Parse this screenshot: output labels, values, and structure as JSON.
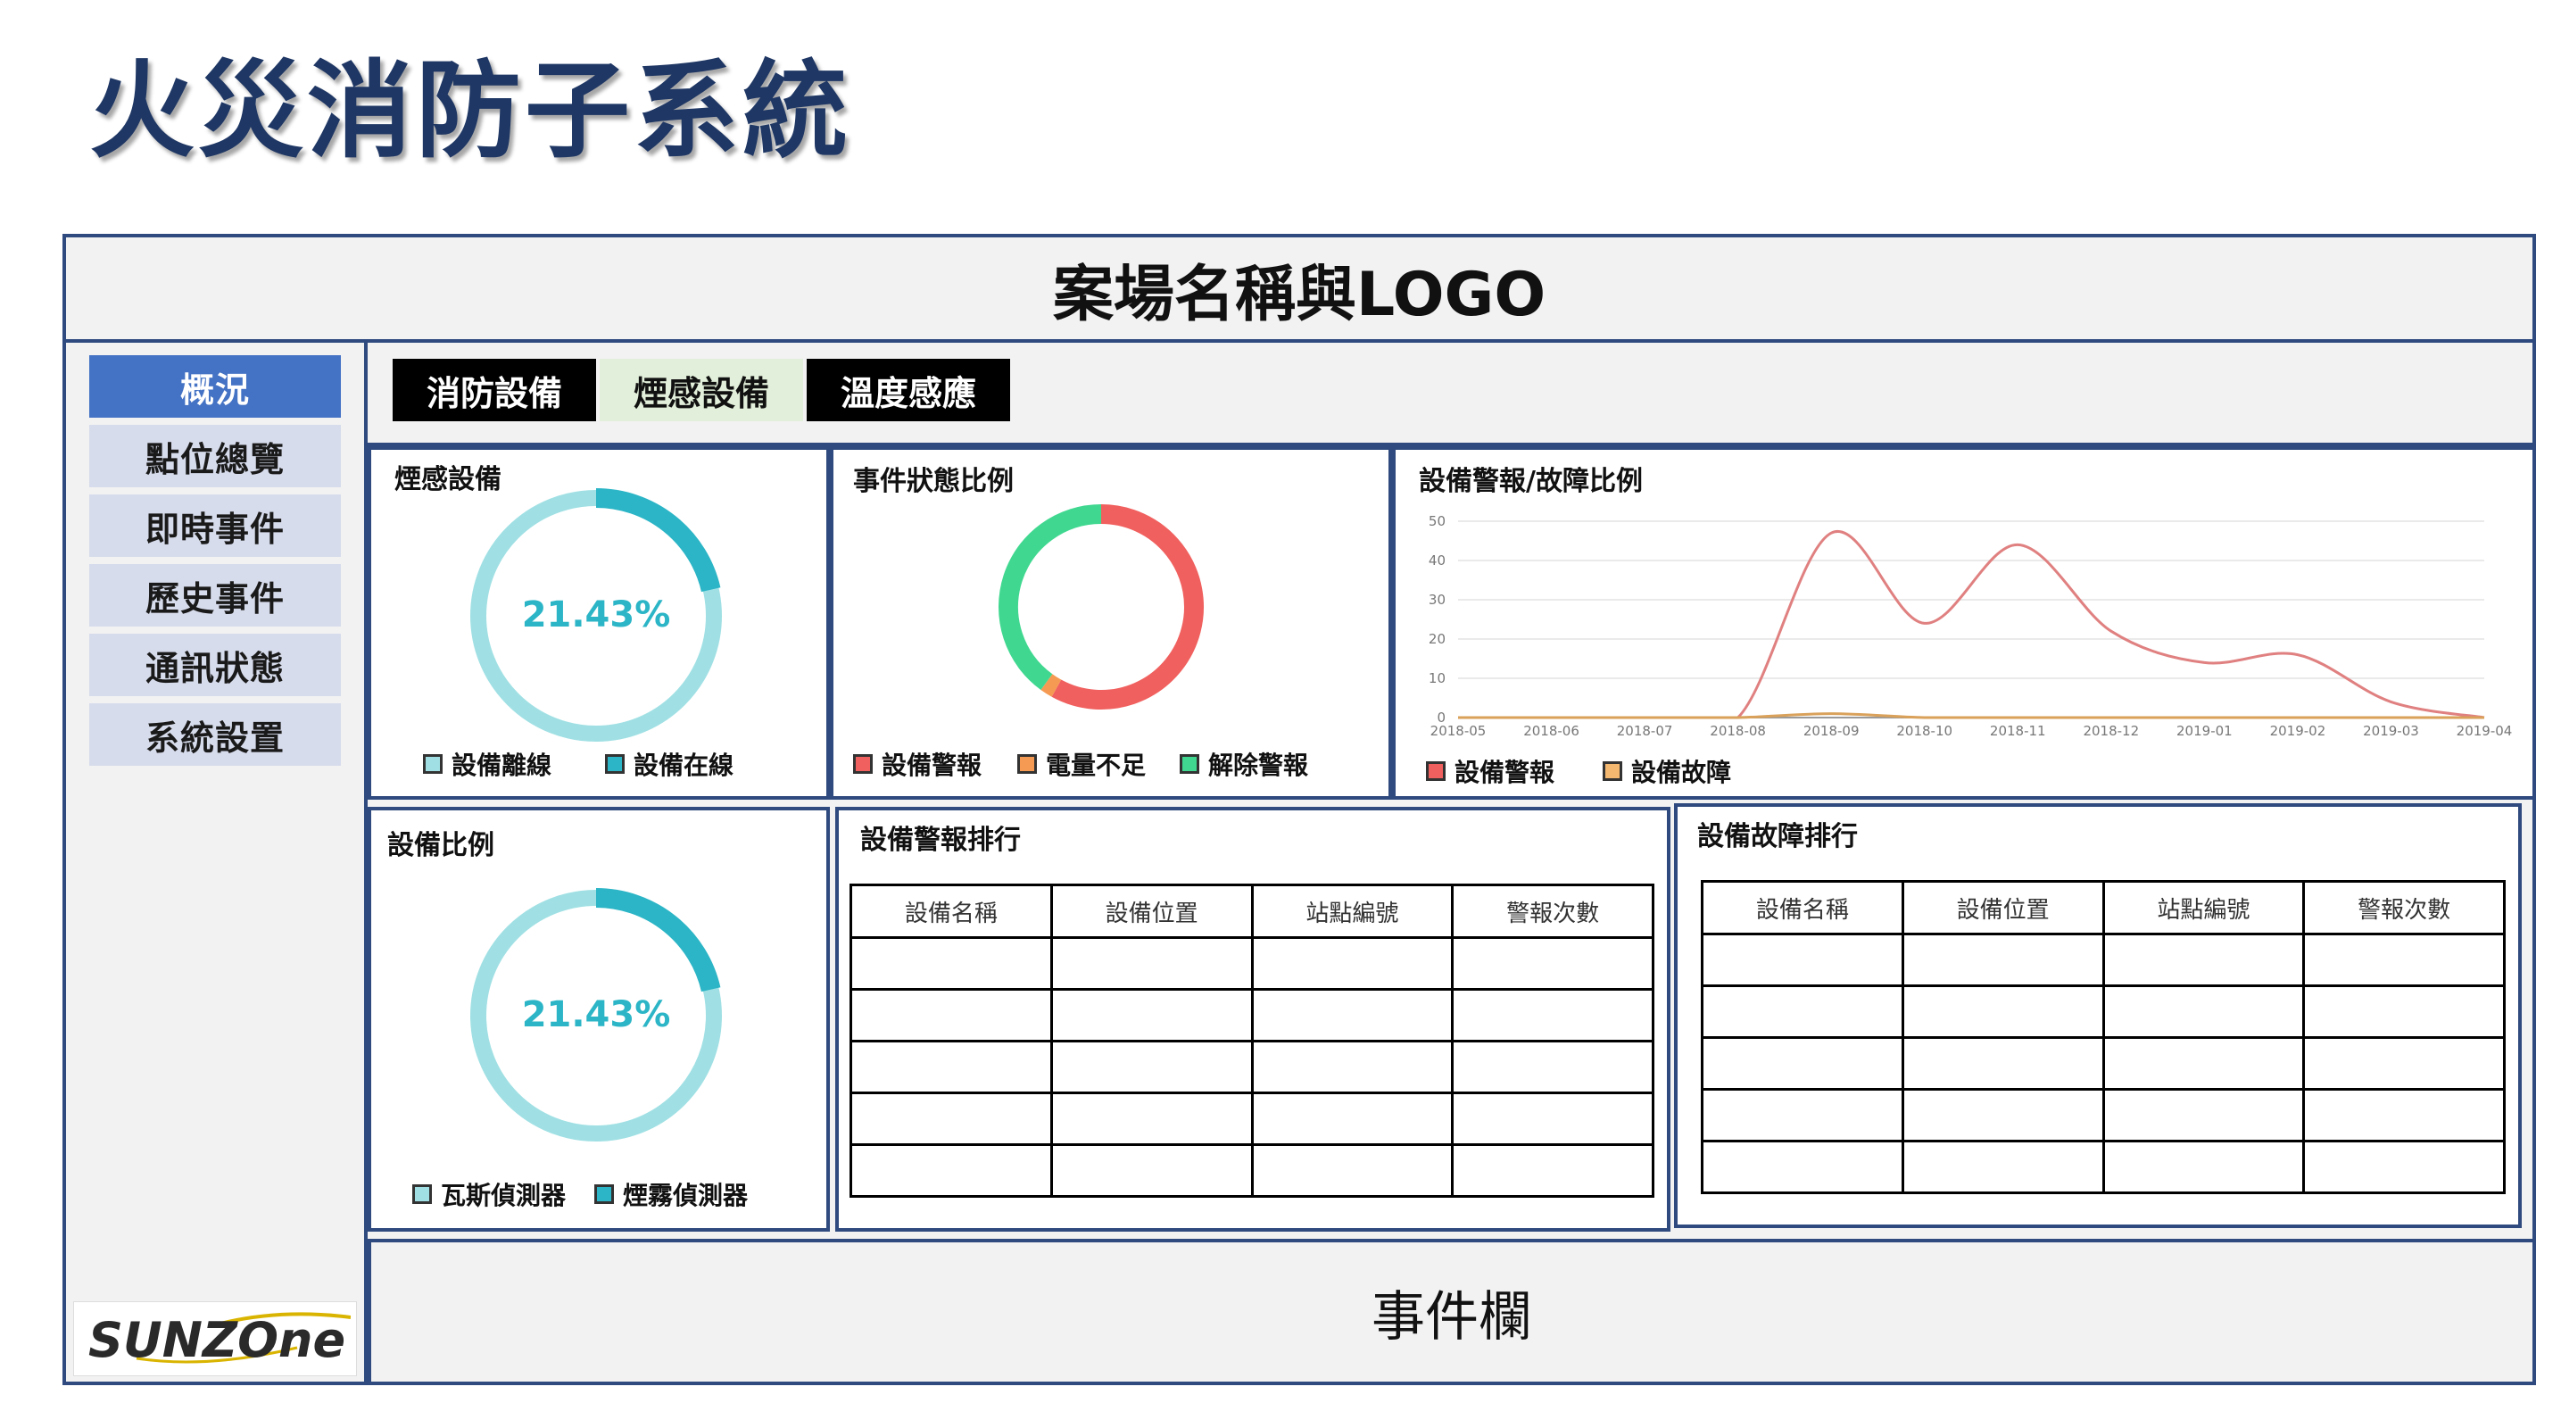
{
  "page": {
    "title": "火災消防子系統"
  },
  "header": {
    "site_label": "案場名稱與LOGO"
  },
  "sidebar": {
    "items": [
      {
        "label": "概況",
        "active": true
      },
      {
        "label": "點位總覽"
      },
      {
        "label": "即時事件"
      },
      {
        "label": "歷史事件"
      },
      {
        "label": "通訊狀態"
      },
      {
        "label": "系統設置"
      }
    ],
    "logo_text": "SUNZOne"
  },
  "tabs": [
    {
      "label": "消防設備",
      "style": "dark"
    },
    {
      "label": "煙感設備",
      "style": "light"
    },
    {
      "label": "溫度感應",
      "style": "dark"
    }
  ],
  "colors": {
    "accent": "#4472c4",
    "frame": "#2f4a7e",
    "ring_light": "#a0e0e4",
    "ring_dark": "#2bb5c6",
    "red": "#f0605e",
    "green": "#40d890",
    "orange": "#f59a52",
    "line_orange": "#d9a15a"
  },
  "panels": {
    "smoke": {
      "title": "煙感設備",
      "value_label": "21.43%",
      "legend": [
        "設備離線",
        "設備在線"
      ]
    },
    "event_status": {
      "title": "事件狀態比例",
      "legend": [
        "設備警報",
        "電量不足",
        "解除警報"
      ]
    },
    "alarm_fault": {
      "title": "設備警報/故障比例",
      "legend": [
        "設備警報",
        "設備故障"
      ]
    },
    "device_ratio": {
      "title": "設備比例",
      "value_label": "21.43%",
      "legend": [
        "瓦斯偵測器",
        "煙霧偵測器"
      ]
    },
    "alarm_rank": {
      "title": "設備警報排行",
      "columns": [
        "設備名稱",
        "設備位置",
        "站點編號",
        "警報次數"
      ]
    },
    "fault_rank": {
      "title": "設備故障排行",
      "columns": [
        "設備名稱",
        "設備位置",
        "站點編號",
        "警報次數"
      ]
    }
  },
  "event_bar": {
    "label": "事件欄"
  },
  "chart_data": [
    {
      "type": "pie",
      "labels": [
        "設備離線",
        "設備在線"
      ],
      "values": [
        78.57,
        21.43
      ],
      "center_label": "21.43%"
    },
    {
      "type": "pie",
      "labels": [
        "設備警報",
        "電量不足",
        "解除警報"
      ],
      "values": [
        58,
        2,
        40
      ]
    },
    {
      "type": "line",
      "x": [
        "2018-05",
        "2018-06",
        "2018-07",
        "2018-08",
        "2018-09",
        "2018-10",
        "2018-11",
        "2018-12",
        "2019-01",
        "2019-02",
        "2019-03",
        "2019-04"
      ],
      "series": [
        {
          "name": "設備警報",
          "values": [
            0,
            0,
            0,
            0,
            47,
            24,
            44,
            22,
            14,
            16,
            4,
            0
          ]
        },
        {
          "name": "設備故障",
          "values": [
            0,
            0,
            0,
            0,
            1,
            0,
            0,
            0,
            0,
            0,
            0,
            0
          ]
        }
      ],
      "ylim": [
        0,
        50
      ],
      "yticks": [
        0,
        10,
        20,
        30,
        40,
        50
      ],
      "grid": true,
      "legend": "bottom-left"
    },
    {
      "type": "pie",
      "labels": [
        "瓦斯偵測器",
        "煙霧偵測器"
      ],
      "values": [
        78.57,
        21.43
      ],
      "center_label": "21.43%"
    }
  ]
}
